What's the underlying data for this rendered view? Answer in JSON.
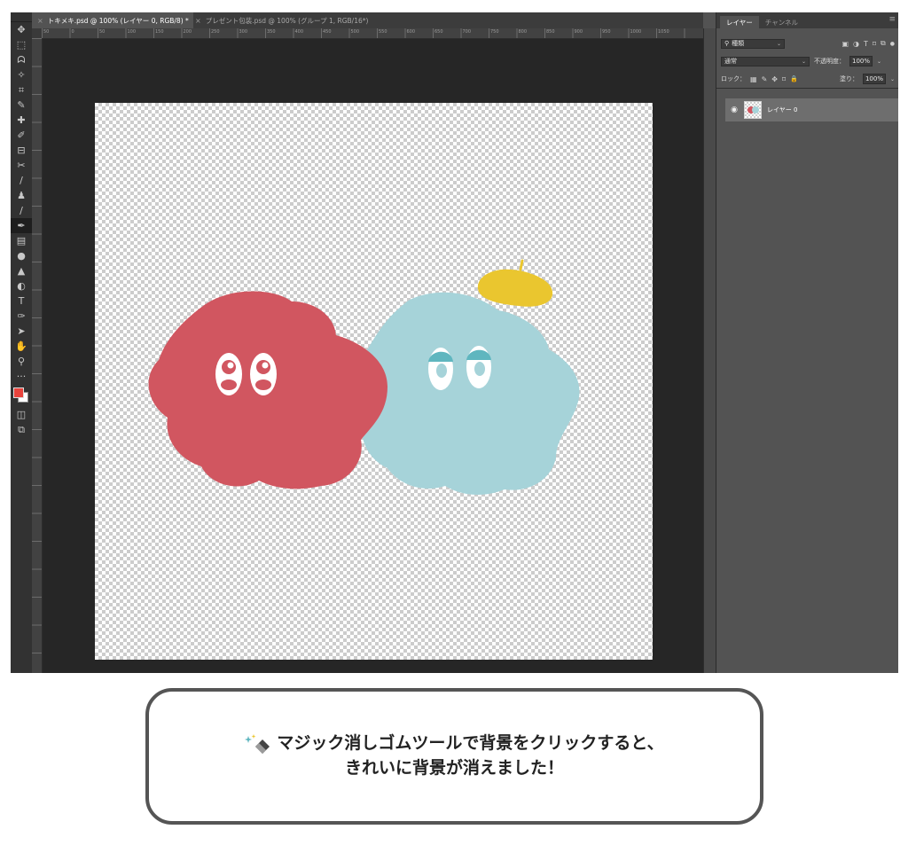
{
  "document_tabs": [
    {
      "label": "トキメキ.psd @ 100% (レイヤー 0, RGB/8) *",
      "active": true
    },
    {
      "label": "プレゼント包装.psd @ 100% (グループ 1, RGB/16*)",
      "active": false
    }
  ],
  "close_glyph": "×",
  "ruler_labels": [
    "50",
    "0",
    "50",
    "100",
    "150",
    "200",
    "250",
    "300",
    "350",
    "400",
    "450",
    "500",
    "550",
    "600",
    "650",
    "700",
    "750",
    "800",
    "850",
    "900",
    "950",
    "1000",
    "1050"
  ],
  "tools": [
    {
      "name": "move-tool",
      "glyph": "✥"
    },
    {
      "name": "marquee-tool",
      "glyph": "⬚"
    },
    {
      "name": "lasso-tool",
      "glyph": "ᗣ"
    },
    {
      "name": "quick-select-tool",
      "glyph": "✧"
    },
    {
      "name": "crop-tool",
      "glyph": "⌗"
    },
    {
      "name": "eyedropper-tool",
      "glyph": "✎"
    },
    {
      "name": "healing-brush-tool",
      "glyph": "✚"
    },
    {
      "name": "brush-tool",
      "glyph": "✐"
    },
    {
      "name": "stamp-tool",
      "glyph": "⊟"
    },
    {
      "name": "history-brush-tool",
      "glyph": "✂"
    },
    {
      "name": "pencil-tool",
      "glyph": "/"
    },
    {
      "name": "clone-stamp-tool",
      "glyph": "♟"
    },
    {
      "name": "smudge-tool",
      "glyph": "∕"
    },
    {
      "name": "magic-eraser-tool",
      "glyph": "✒",
      "active": true
    },
    {
      "name": "gradient-tool",
      "glyph": "▤"
    },
    {
      "name": "blur-tool",
      "glyph": "●"
    },
    {
      "name": "sharpen-tool",
      "glyph": "▲"
    },
    {
      "name": "dodge-tool",
      "glyph": "◐"
    },
    {
      "name": "type-tool",
      "glyph": "T"
    },
    {
      "name": "pen-tool",
      "glyph": "✑"
    },
    {
      "name": "path-select-tool",
      "glyph": "➤"
    },
    {
      "name": "hand-tool",
      "glyph": "✋"
    },
    {
      "name": "zoom-tool",
      "glyph": "⚲"
    },
    {
      "name": "more-tools",
      "glyph": "···"
    }
  ],
  "tools_bottom": [
    {
      "name": "quick-mask-tool",
      "glyph": "◫"
    },
    {
      "name": "screen-mode-tool",
      "glyph": "⧉"
    }
  ],
  "colors": {
    "foreground": "#e8433c",
    "background": "#ffffff",
    "red_blob": "#d15660",
    "blue_blob": "#a6d3d9",
    "beret": "#eac62f"
  },
  "panel": {
    "tabs": [
      "レイヤー",
      "チャンネル"
    ],
    "menu_glyph": "≡",
    "kind_label": "種類",
    "search_glyph": "⚲",
    "chevron": "⌄",
    "filter_icons": [
      "▣",
      "◑",
      "T",
      "⌑",
      "⧉",
      "●"
    ],
    "blend_mode": "通常",
    "opacity_label": "不透明度：",
    "opacity_value": "100%",
    "lock_label": "ロック：",
    "lock_icons": [
      "▦",
      "✎",
      "✥",
      "⌑",
      "🔒"
    ],
    "fill_label": "塗り：",
    "fill_value": "100%",
    "layer_name": "レイヤー 0",
    "eye_glyph": "◉"
  },
  "caption": {
    "line1": "マジック消しゴムツールで背景をクリックすると、",
    "line2": "きれいに背景が消えました！"
  }
}
